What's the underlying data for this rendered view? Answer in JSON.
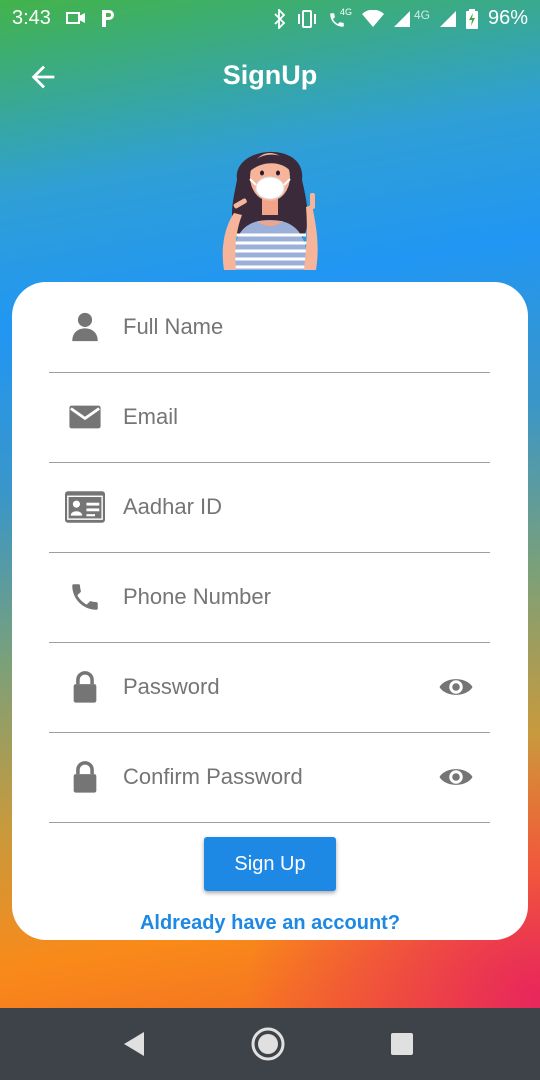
{
  "status_bar": {
    "time": "3:43",
    "network_4g_a": "4G",
    "network_4g_b": "4G",
    "battery": "96%"
  },
  "header": {
    "title": "SignUp"
  },
  "form": {
    "fields": [
      {
        "placeholder": "Full Name",
        "icon": "person-icon"
      },
      {
        "placeholder": "Email",
        "icon": "email-icon"
      },
      {
        "placeholder": "Aadhar ID",
        "icon": "id-card-icon"
      },
      {
        "placeholder": "Phone Number",
        "icon": "phone-icon"
      },
      {
        "placeholder": "Password",
        "icon": "lock-icon"
      },
      {
        "placeholder": "Confirm Password",
        "icon": "lock-icon"
      }
    ],
    "submit_label": "Sign Up",
    "login_link": "Aldready have an account?"
  },
  "colors": {
    "accent": "#1e88e5",
    "navbar": "#3e4349",
    "icon_grey": "#757575"
  }
}
